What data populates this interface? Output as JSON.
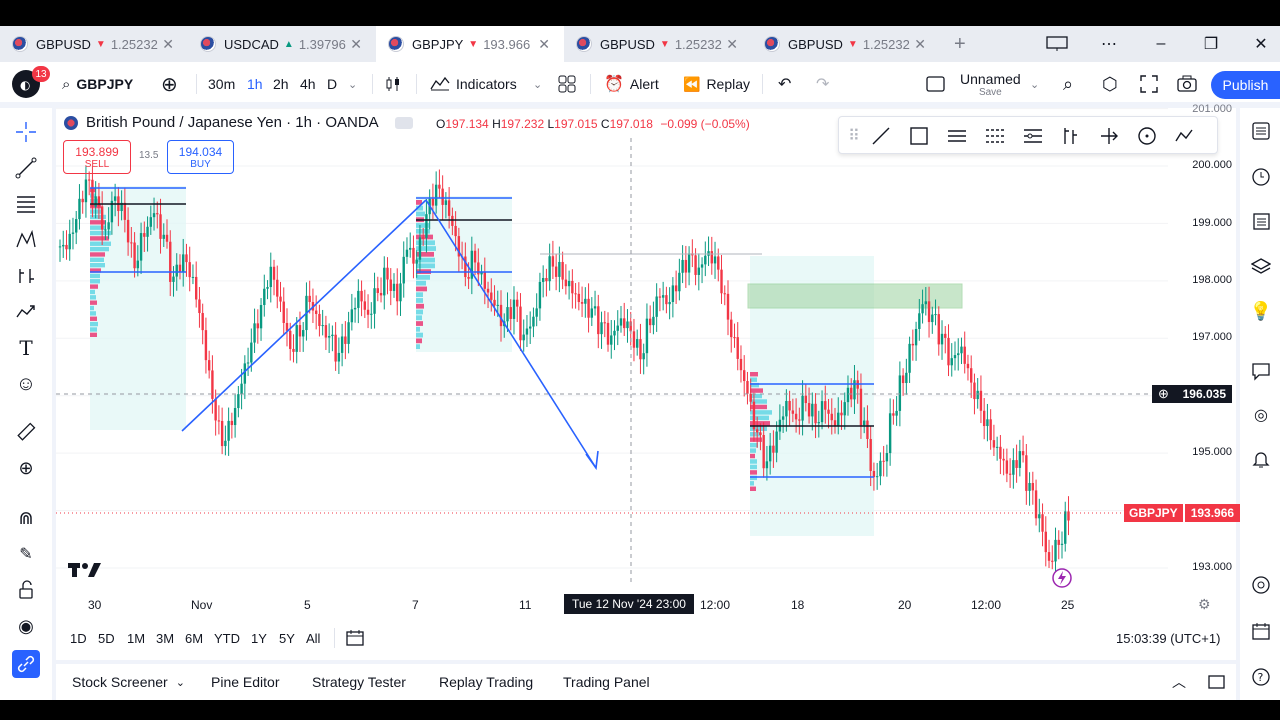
{
  "tabs": [
    {
      "symbol": "GBPUSD",
      "dir": "down",
      "price": "1.25232"
    },
    {
      "symbol": "USDCAD",
      "dir": "up",
      "price": "1.39796"
    },
    {
      "symbol": "GBPJPY",
      "dir": "down",
      "price": "193.966"
    },
    {
      "symbol": "GBPUSD",
      "dir": "down",
      "price": "1.25232"
    },
    {
      "symbol": "GBPUSD",
      "dir": "down",
      "price": "1.25232"
    }
  ],
  "toolbar": {
    "notifications": "13",
    "symbol": "GBPJPY",
    "intervals": [
      "30m",
      "1h",
      "2h",
      "4h",
      "D"
    ],
    "selected_interval": "1h",
    "indicators_label": "Indicators",
    "alert_label": "Alert",
    "replay_label": "Replay",
    "layout_name": "Unnamed",
    "layout_sub": "Save",
    "publish_label": "Publish"
  },
  "legend": {
    "title": "British Pound / Japanese Yen · 1h · OANDA",
    "open_label": "O",
    "open": "197.134",
    "high_label": "H",
    "high": "197.232",
    "low_label": "L",
    "low": "197.015",
    "close_label": "C",
    "close": "197.018",
    "change": "−0.099 (−0.05%)",
    "sell_price": "193.899",
    "sell_label": "SELL",
    "spread": "13.5",
    "buy_price": "194.034",
    "buy_label": "BUY"
  },
  "chart_data": {
    "type": "candlestick",
    "symbol": "GBPJPY",
    "y_ticks": [
      "201.000",
      "200.000",
      "199.000",
      "198.000",
      "197.000",
      "196.000",
      "195.000",
      "194.000",
      "193.000"
    ],
    "ylim": [
      192.6,
      201.0
    ],
    "x_ticks": [
      "30",
      "Nov",
      "5",
      "7",
      "11",
      "12:00",
      "18",
      "20",
      "12:00",
      "25"
    ],
    "crosshair_time": "Tue 12 Nov '24  23:00",
    "crosshair_price": "196.035",
    "last_price_label": "GBPJPY",
    "last_price": "193.966",
    "path": [
      198.6,
      199.0,
      199.6,
      199.3,
      198.8,
      199.5,
      199.2,
      198.4,
      198.9,
      199.2,
      198.7,
      197.9,
      198.3,
      198.0,
      197.2,
      196.1,
      195.3,
      195.6,
      196.2,
      196.8,
      197.4,
      198.1,
      197.6,
      196.9,
      197.2,
      197.8,
      197.3,
      197.0,
      196.6,
      197.1,
      197.7,
      197.4,
      197.9,
      198.2,
      197.8,
      198.6,
      198.3,
      199.0,
      199.5,
      199.3,
      198.8,
      198.2,
      198.5,
      198.0,
      197.6,
      197.2,
      197.5,
      196.9,
      197.3,
      198.1,
      198.4,
      198.2,
      197.9,
      197.6,
      197.4,
      197.1,
      196.9,
      197.3,
      197.2,
      196.8,
      197.4,
      197.8,
      197.6,
      198.0,
      198.3,
      198.1,
      198.5,
      198.3,
      197.5,
      196.8,
      196.1,
      195.3,
      194.7,
      195.2,
      195.8,
      195.6,
      196.0,
      195.7,
      195.9,
      195.5,
      195.8,
      196.1,
      195.4,
      194.5,
      194.9,
      195.8,
      196.4,
      197.0,
      197.6,
      197.3,
      196.9,
      196.5,
      196.8,
      196.3,
      195.9,
      195.4,
      195.0,
      194.6,
      194.9,
      194.3,
      193.8,
      193.1,
      193.5,
      194.0
    ]
  },
  "ranges": [
    "1D",
    "5D",
    "1M",
    "3M",
    "6M",
    "YTD",
    "1Y",
    "5Y",
    "All"
  ],
  "clock": "15:03:39 (UTC+1)",
  "bottom_tabs": [
    "Stock Screener",
    "Pine Editor",
    "Strategy Tester",
    "Replay Trading",
    "Trading Panel"
  ],
  "colors": {
    "accent": "#2962ff",
    "down": "#f23645",
    "up": "#089981",
    "zone": "#a5d6a7",
    "volume_profile": "#e91e63"
  }
}
